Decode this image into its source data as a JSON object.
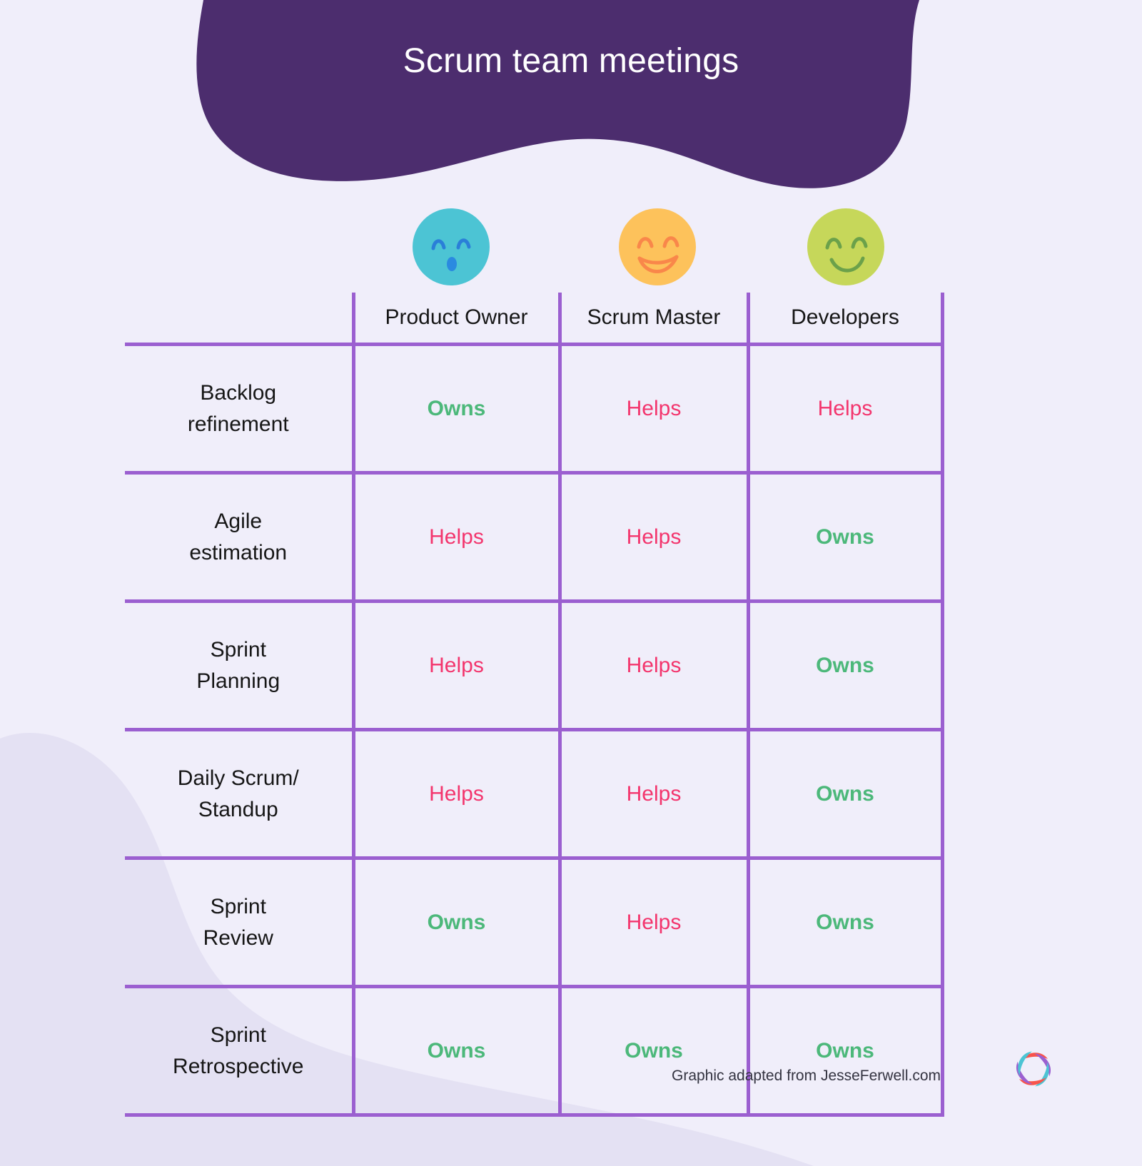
{
  "header": {
    "title": "Scrum team meetings",
    "banner_color": "#4c2d6e",
    "background_color": "#f0eefa"
  },
  "avatars": [
    {
      "role": "Product Owner",
      "icon": "surprised-face-icon",
      "color": "#4cc4d4",
      "stroke": "#2a7fd8",
      "expression": "surprised"
    },
    {
      "role": "Scrum Master",
      "icon": "grinning-face-icon",
      "color": "#fdc25b",
      "stroke": "#f98a4d",
      "expression": "grinning"
    },
    {
      "role": "Developers",
      "icon": "smiling-face-icon",
      "color": "#c6d75a",
      "stroke": "#6ba14a",
      "expression": "smiling"
    }
  ],
  "table": {
    "corner_label": "",
    "columns": [
      "Product Owner",
      "Scrum Master",
      "Developers"
    ],
    "rows": [
      {
        "label": "Backlog\nrefinement",
        "label_lines": [
          "Backlog",
          "refinement"
        ],
        "values": [
          "Owns",
          "Helps",
          "Helps"
        ]
      },
      {
        "label": "Agile\nestimation",
        "label_lines": [
          "Agile",
          "estimation"
        ],
        "values": [
          "Helps",
          "Helps",
          "Owns"
        ]
      },
      {
        "label": "Sprint\nPlanning",
        "label_lines": [
          "Sprint",
          "Planning"
        ],
        "values": [
          "Helps",
          "Helps",
          "Owns"
        ]
      },
      {
        "label": "Daily Scrum/\nStandup",
        "label_lines": [
          "Daily Scrum/",
          "Standup"
        ],
        "values": [
          "Helps",
          "Helps",
          "Owns"
        ]
      },
      {
        "label": "Sprint\nReview",
        "label_lines": [
          "Sprint",
          "Review"
        ],
        "values": [
          "Owns",
          "Helps",
          "Owns"
        ]
      },
      {
        "label": "Sprint\nRetrospective",
        "label_lines": [
          "Sprint",
          "Retrospective"
        ],
        "values": [
          "Owns",
          "Owns",
          "Owns"
        ]
      }
    ],
    "legend": {
      "owns_label": "Owns",
      "helps_label": "Helps",
      "owns_color": "#4cb87a",
      "helps_color": "#f3356d",
      "grid_color": "#9b5fd0"
    }
  },
  "footer": {
    "credit": "Graphic adapted from JesseFerwell.com",
    "logo_name": "pinwheel-logo",
    "logo_colors": [
      "#f8544b",
      "#9b5fd0",
      "#4cc4d4"
    ]
  }
}
